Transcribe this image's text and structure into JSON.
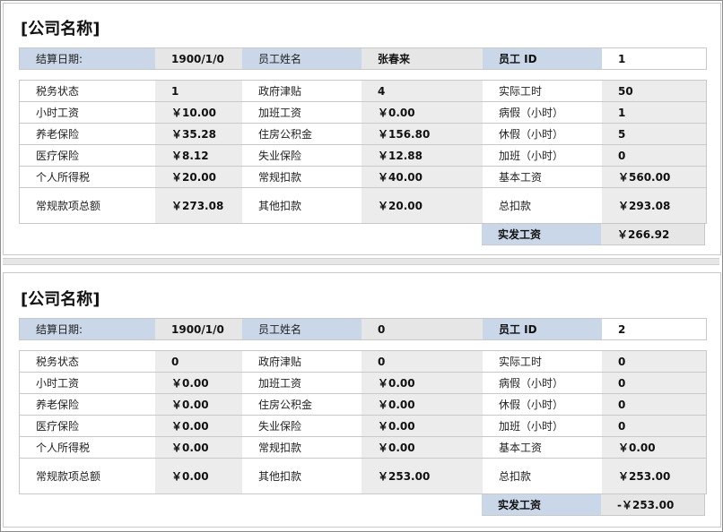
{
  "slips": [
    {
      "company": "[公司名称]",
      "header": {
        "settle_label": "结算日期:",
        "settle_value": "1900/1/0",
        "name_label": "员工姓名",
        "name_value": "张春来",
        "id_label": "员工 ID",
        "id_value": "1"
      },
      "rows": [
        [
          "税务状态",
          "1",
          "政府津贴",
          "4",
          "实际工时",
          "50"
        ],
        [
          "小时工资",
          "￥10.00",
          "加班工资",
          "￥0.00",
          "病假（小时）",
          "1"
        ],
        [
          "养老保险",
          "￥35.28",
          "住房公积金",
          "￥156.80",
          "休假（小时）",
          "5"
        ],
        [
          "医疗保险",
          "￥8.12",
          "失业保险",
          "￥12.88",
          "加班（小时）",
          "0"
        ],
        [
          "个人所得税",
          "￥20.00",
          "常规扣款",
          "￥40.00",
          "基本工资",
          "￥560.00"
        ],
        [
          "常规款项总额",
          "￥273.08",
          "其他扣款",
          "￥20.00",
          "总扣款",
          "￥293.08"
        ]
      ],
      "net_label": "实发工资",
      "net_value": "￥266.92"
    },
    {
      "company": "[公司名称]",
      "header": {
        "settle_label": "结算日期:",
        "settle_value": "1900/1/0",
        "name_label": "员工姓名",
        "name_value": "0",
        "id_label": "员工 ID",
        "id_value": "2"
      },
      "rows": [
        [
          "税务状态",
          "0",
          "政府津贴",
          "0",
          "实际工时",
          "0"
        ],
        [
          "小时工资",
          "￥0.00",
          "加班工资",
          "￥0.00",
          "病假（小时）",
          "0"
        ],
        [
          "养老保险",
          "￥0.00",
          "住房公积金",
          "￥0.00",
          "休假（小时）",
          "0"
        ],
        [
          "医疗保险",
          "￥0.00",
          "失业保险",
          "￥0.00",
          "加班（小时）",
          "0"
        ],
        [
          "个人所得税",
          "￥0.00",
          "常规扣款",
          "￥0.00",
          "基本工资",
          "￥0.00"
        ],
        [
          "常规款项总额",
          "￥0.00",
          "其他扣款",
          "￥253.00",
          "总扣款",
          "￥253.00"
        ]
      ],
      "net_label": "实发工资",
      "net_value": "-￥253.00"
    }
  ]
}
